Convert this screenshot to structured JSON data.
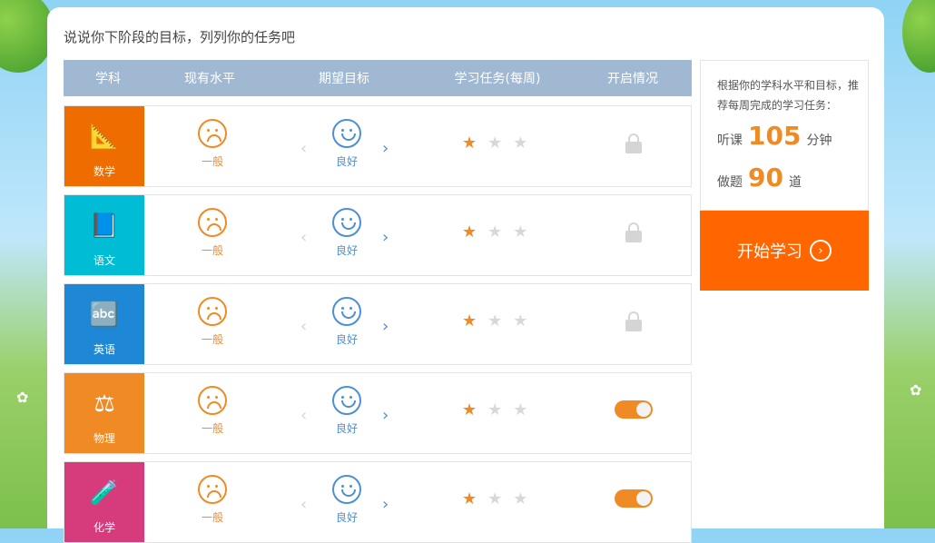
{
  "header": {
    "title": "说说你下阶段的目标，列列你的任务吧"
  },
  "table": {
    "columns": [
      "学科",
      "现有水平",
      "期望目标",
      "学习任务(每周)",
      "开启情况"
    ],
    "rows": [
      {
        "subject": "数学",
        "level": "一般",
        "target": "良好",
        "stars": 1,
        "status": "locked",
        "color": "#ef6c00",
        "icon": "ruler-icon"
      },
      {
        "subject": "语文",
        "level": "一般",
        "target": "良好",
        "stars": 1,
        "status": "locked",
        "color": "#00bcd4",
        "icon": "book-icon"
      },
      {
        "subject": "英语",
        "level": "一般",
        "target": "良好",
        "stars": 1,
        "status": "locked",
        "color": "#1e88d6",
        "icon": "blocks-icon"
      },
      {
        "subject": "物理",
        "level": "一般",
        "target": "良好",
        "stars": 1,
        "status": "on",
        "color": "#f08a24",
        "icon": "scale-icon"
      },
      {
        "subject": "化学",
        "level": "一般",
        "target": "良好",
        "stars": 1,
        "status": "on",
        "color": "#d63c7b",
        "icon": "test-tube-icon"
      }
    ]
  },
  "side": {
    "desc": "根据你的学科水平和目标，推荐每周完成的学习任务：",
    "listen_label": "听课",
    "listen_value": "105",
    "listen_unit": "分钟",
    "practice_label": "做题",
    "practice_value": "90",
    "practice_unit": "道",
    "start_button": "开始学习"
  }
}
